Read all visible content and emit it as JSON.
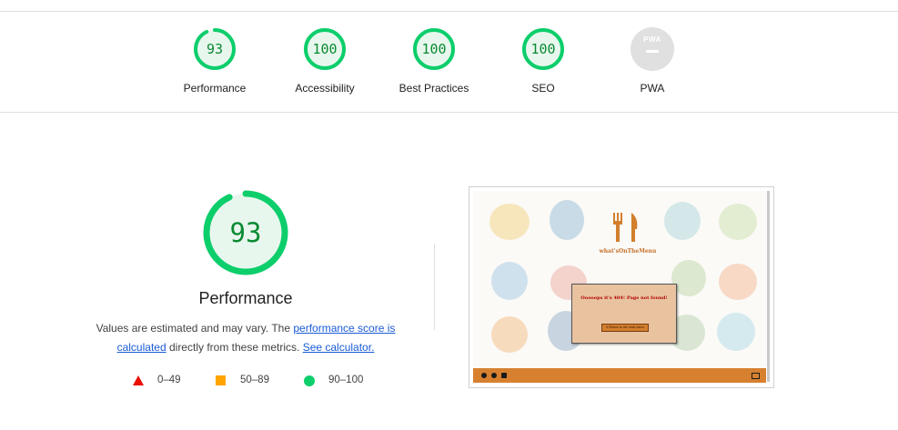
{
  "categories": [
    {
      "label": "Performance",
      "score": "93",
      "score_value": 93
    },
    {
      "label": "Accessibility",
      "score": "100",
      "score_value": 100
    },
    {
      "label": "Best Practices",
      "score": "100",
      "score_value": 100
    },
    {
      "label": "SEO",
      "score": "100",
      "score_value": 100
    },
    {
      "label": "PWA",
      "badge": "PWA",
      "score": "—"
    }
  ],
  "detail": {
    "score": "93",
    "score_value": 93,
    "title": "Performance",
    "desc_pre": "Values are estimated and may vary. The ",
    "desc_link1": "performance score is calculated",
    "desc_mid": " directly from these metrics. ",
    "desc_link2": "See calculator."
  },
  "legend": [
    {
      "range": "0–49",
      "shape": "triangle",
      "color": "#eb0f00"
    },
    {
      "range": "50–89",
      "shape": "square",
      "color": "#ffa400"
    },
    {
      "range": "90–100",
      "shape": "circle",
      "color": "#0cce6b"
    }
  ],
  "colors": {
    "pass": "#0cce6b",
    "pass_text": "#0a8a32",
    "pass_bg": "#e8f7ee",
    "pwa_gray": "#e0e0e0"
  },
  "screenshot": {
    "logo_text": "what'sOnTheMenu",
    "modal_title": "Ooooops it's 404! Page not found!",
    "modal_button": "⟲ Return to the main menu",
    "footer_icons": [
      "facebook-icon",
      "pinterest-icon",
      "instagram-icon",
      "mail-icon"
    ]
  }
}
